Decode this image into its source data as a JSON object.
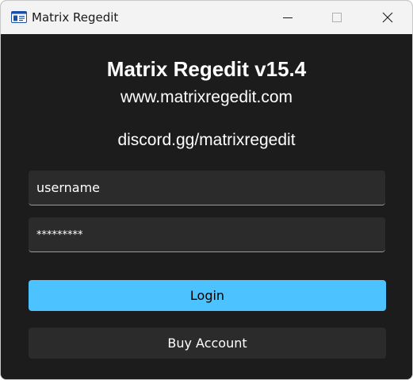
{
  "window": {
    "title": "Matrix Regedit",
    "controls": [
      "minimize-icon",
      "maximize-icon",
      "close-icon"
    ]
  },
  "header": {
    "app_title": "Matrix Regedit v15.4",
    "website": "www.matrixregedit.com",
    "discord": "discord.gg/matrixregedit"
  },
  "form": {
    "username_value": "username",
    "password_value": "*********"
  },
  "buttons": {
    "login_label": "Login",
    "buy_label": "Buy Account"
  },
  "colors": {
    "accent": "#4cc2ff",
    "background": "#1c1c1c",
    "field": "#2b2b2b",
    "titlebar": "#f3f3f3"
  }
}
